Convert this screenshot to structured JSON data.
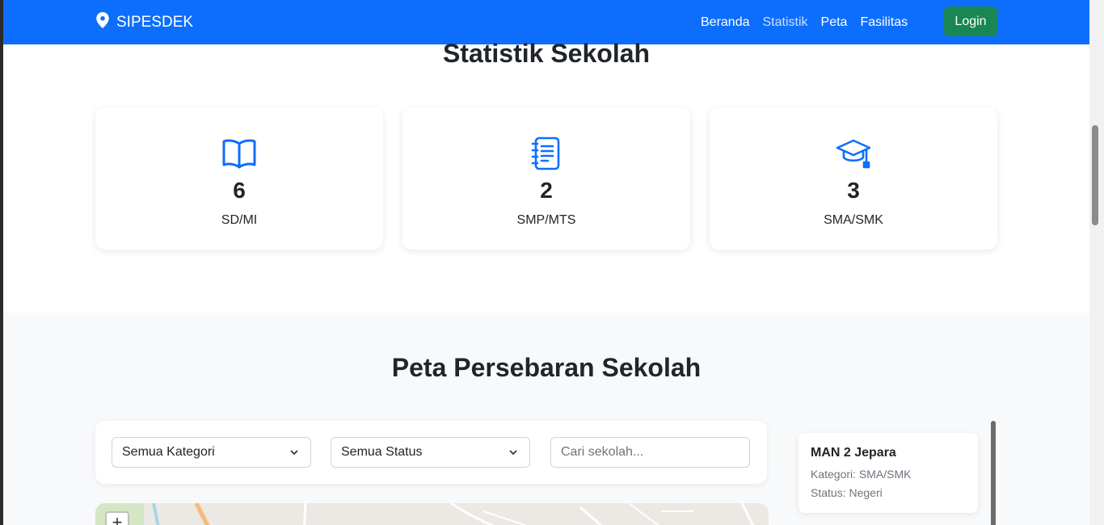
{
  "navbar": {
    "brand": "SIPESDEK",
    "brand_icon": "map-pin-icon",
    "links": [
      "Beranda",
      "Statistik",
      "Peta",
      "Fasilitas"
    ],
    "active_link": "Statistik",
    "login_label": "Login"
  },
  "statistik": {
    "title": "Statistik Sekolah",
    "cards": [
      {
        "icon": "book-icon",
        "count": "6",
        "label": "SD/MI"
      },
      {
        "icon": "journal-icon",
        "count": "2",
        "label": "SMP/MTS"
      },
      {
        "icon": "mortarboard-icon",
        "count": "3",
        "label": "SMA/SMK"
      }
    ]
  },
  "peta": {
    "title": "Peta Persebaran Sekolah",
    "filters": {
      "kategori_selected": "Semua Kategori",
      "status_selected": "Semua Status",
      "search_placeholder": "Cari sekolah..."
    },
    "zoom_in_label": "+",
    "schools": [
      {
        "name": "MAN 2 Jepara",
        "kategori": "Kategori: SMA/SMK",
        "status": "Status: Negeri"
      }
    ]
  },
  "colors": {
    "primary": "#0d6efd",
    "success": "#198754",
    "section_bg": "#f8f9fa"
  }
}
